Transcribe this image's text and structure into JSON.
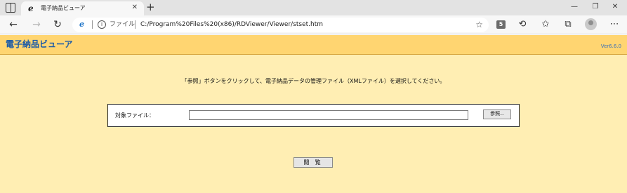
{
  "browser": {
    "tab_title": "電子納品ビューア",
    "tab_favicon": "e",
    "address_protocol": "ファイル",
    "address_url": "C:/Program%20Files%20(x86)/RDViewer/Viewer/stset.htm",
    "extension_badge": "5"
  },
  "icons": {
    "window_menu": "window-icon",
    "favicon": "ie-mode-icon",
    "close_tab": "close-icon",
    "new_tab": "plus-icon",
    "minimize": "minimize-icon",
    "restore": "restore-icon",
    "close_window": "close-icon",
    "back": "back-arrow-icon",
    "forward": "forward-arrow-icon",
    "refresh": "refresh-icon",
    "info": "info-icon",
    "add_favorite": "add-favorite-icon",
    "extension": "extension-icon",
    "favorites": "favorites-icon",
    "collections": "collections-icon",
    "profile": "avatar-icon",
    "more": "more-icon"
  },
  "app": {
    "title": "電子納品ビューア",
    "version": "Ver6.6.0",
    "instruction": "「参照」ボタンをクリックして、電子納品データの管理ファイル（XMLファイル）を選択してください。",
    "file_label": "対象ファイル：",
    "file_value": "",
    "browse_label": "参照...",
    "view_label": "閲 覧"
  },
  "colors": {
    "page_background": "#ffeeb3",
    "header_background": "#ffd571",
    "title_text": "#1a5aa8"
  }
}
